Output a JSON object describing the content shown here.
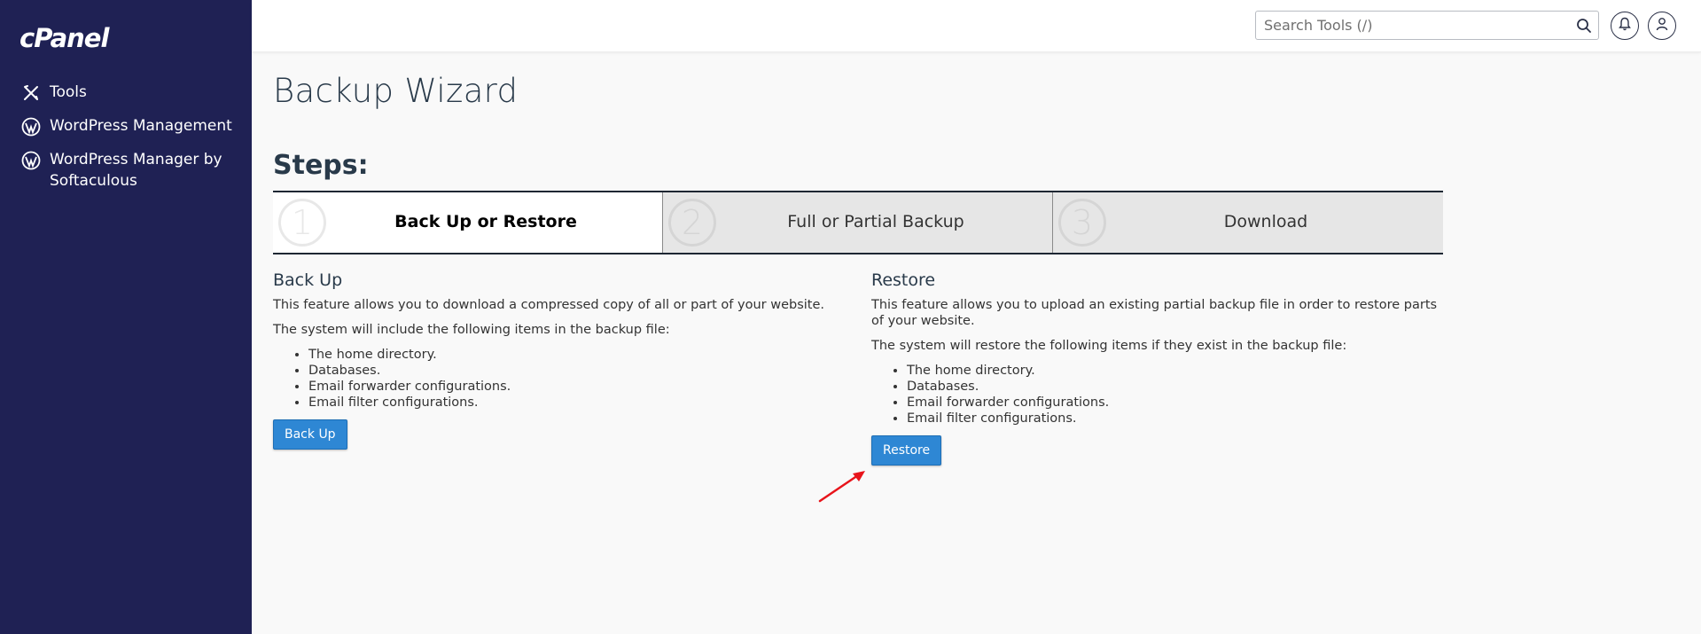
{
  "brand": {
    "logo_text": "cPanel"
  },
  "sidebar": {
    "items": [
      {
        "label": "Tools",
        "icon": "tools-icon"
      },
      {
        "label": "WordPress Management",
        "icon": "wordpress-icon"
      },
      {
        "label": "WordPress Manager by Softaculous",
        "icon": "wordpress-icon"
      }
    ]
  },
  "topbar": {
    "search_placeholder": "Search Tools (/)",
    "icons": [
      "search-icon",
      "bell-icon",
      "user-icon"
    ]
  },
  "page": {
    "title": "Backup Wizard",
    "steps_heading": "Steps:",
    "steps": [
      {
        "number": "1",
        "label": "Back Up or Restore",
        "active": true
      },
      {
        "number": "2",
        "label": "Full or Partial Backup",
        "active": false
      },
      {
        "number": "3",
        "label": "Download",
        "active": false
      }
    ]
  },
  "backup": {
    "heading": "Back Up",
    "description": "This feature allows you to download a compressed copy of all or part of your website.",
    "intro": "The system will include the following items in the backup file:",
    "items": [
      "The home directory.",
      "Databases.",
      "Email forwarder configurations.",
      "Email filter configurations."
    ],
    "button_label": "Back Up"
  },
  "restore": {
    "heading": "Restore",
    "description": "This feature allows you to upload an existing partial backup file in order to restore parts of your website.",
    "intro": "The system will restore the following items if they exist in the backup file:",
    "items": [
      "The home directory.",
      "Databases.",
      "Email forwarder configurations.",
      "Email filter configurations."
    ],
    "button_label": "Restore"
  },
  "colors": {
    "sidebar_bg": "#1f2154",
    "button_blue": "#2e87d4",
    "annotation_arrow": "#e8141b"
  }
}
